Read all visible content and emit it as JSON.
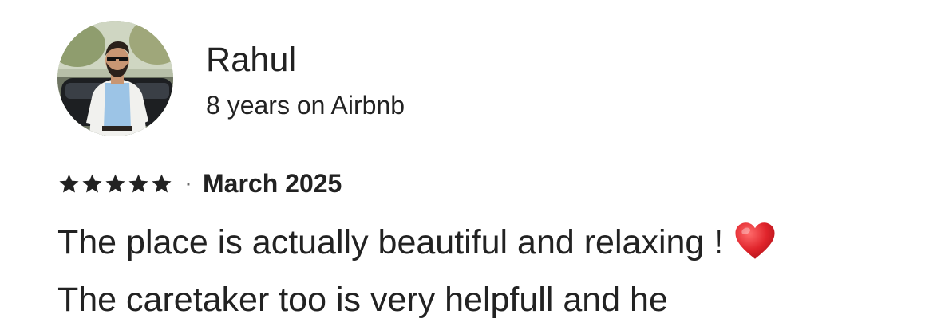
{
  "reviewer": {
    "name": "Rahul",
    "tenure": "8 years on Airbnb",
    "avatar_icon": "person-photo-avatar"
  },
  "rating": {
    "stars": 5,
    "max_stars": 5,
    "star_icon": "star-icon",
    "separator": "·",
    "date": "March 2025"
  },
  "review": {
    "line1": "The place is actually beautiful and relaxing !",
    "emoji_icon": "red-heart-icon",
    "line2": "The caretaker too is very helpfull and he"
  },
  "colors": {
    "text": "#222222",
    "muted": "#6a6a6a",
    "heart": "#e0242b"
  }
}
